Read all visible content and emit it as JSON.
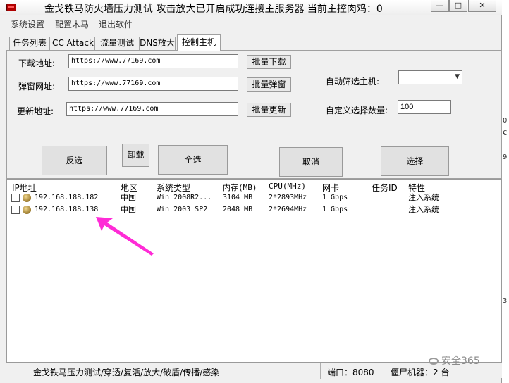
{
  "window": {
    "title": "金戈铁马防火墙压力测试 攻击放大已开启成功连接主服务器 当前主控肉鸡：0",
    "minimize_glyph": "—",
    "maximize_glyph": "□",
    "close_glyph": "✕"
  },
  "menu": [
    "系统设置",
    "配置木马",
    "退出软件"
  ],
  "tabs": [
    "任务列表",
    "CC Attack",
    "流量测试",
    "DNS放大",
    "控制主机"
  ],
  "active_tab": "控制主机",
  "control": {
    "download_label": "下载地址:",
    "download_value": "https://www.77169.com",
    "download_button": "批量下载",
    "popup_label": "弹窗网址:",
    "popup_value": "https://www.77169.com",
    "popup_button": "批量弹窗",
    "update_label": "更新地址:",
    "update_value": "https://www.77169.com",
    "update_button": "批量更新",
    "auto_filter_label": "自动筛选主机:",
    "auto_filter_value": "",
    "custom_count_label": "自定义选择数量:",
    "custom_count_value": "100",
    "buttons": {
      "invert": "反选",
      "uninstall": "卸载",
      "select_all": "全选",
      "cancel": "取消",
      "select": "选择"
    }
  },
  "host_list": {
    "columns": [
      "IP地址",
      "地区",
      "系统类型",
      "内存(MB)",
      "CPU(MHz)",
      "网卡",
      "任务ID",
      "特性"
    ],
    "rows": [
      {
        "ip": "192.168.188.182",
        "region": "中国",
        "os": "Win 2008R2...",
        "memory": "3104 MB",
        "cpu": "2*2893MHz",
        "nic": "1 Gbps",
        "task_id": "",
        "feature": "注入系统",
        "checked": false
      },
      {
        "ip": "192.168.188.138",
        "region": "中国",
        "os": "Win 2003 SP2",
        "memory": "2048 MB",
        "cpu": "2*2694MHz",
        "nic": "1 Gbps",
        "task_id": "",
        "feature": "注入系统",
        "checked": false
      }
    ]
  },
  "status": {
    "product": "金戈铁马压力测试/穿透/复活/放大/破盾/传播/感染",
    "port": "端口：8080",
    "bots": "僵尸机器：2 台"
  },
  "watermark": "安全365",
  "right_strip_marks": [
    "0",
    "€",
    "9",
    "3"
  ],
  "colors": {
    "window_bg": "#f0f0f0",
    "arrow": "#ff2bd6",
    "app_icon": "#b10000"
  }
}
